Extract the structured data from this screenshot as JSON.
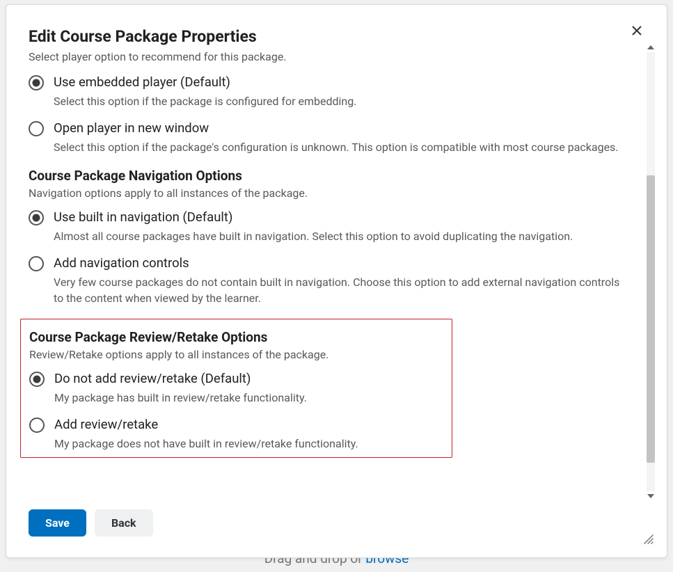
{
  "backdrop": {
    "drag_text": "Drag and drop or ",
    "browse": "browse"
  },
  "dialog": {
    "title": "Edit Course Package Properties",
    "subtitle": "Select player option to recommend for this package."
  },
  "player": {
    "options": [
      {
        "label": "Use embedded player (Default)",
        "desc": "Select this option if the package is configured for embedding.",
        "selected": true
      },
      {
        "label": "Open player in new window",
        "desc": "Select this option if the package's configuration is unknown. This option is compatible with most course packages.",
        "selected": false
      }
    ]
  },
  "navigation": {
    "heading": "Course Package Navigation Options",
    "subheading": "Navigation options apply to all instances of the package.",
    "options": [
      {
        "label": "Use built in navigation (Default)",
        "desc": "Almost all course packages have built in navigation. Select this option to avoid duplicating the navigation.",
        "selected": true
      },
      {
        "label": "Add navigation controls",
        "desc": "Very few course packages do not contain built in navigation. Choose this option to add external navigation controls to the content when viewed by the learner.",
        "selected": false
      }
    ]
  },
  "review": {
    "heading": "Course Package Review/Retake Options",
    "subheading": "Review/Retake options apply to all instances of the package.",
    "options": [
      {
        "label": "Do not add review/retake (Default)",
        "desc": "My package has built in review/retake functionality.",
        "selected": true
      },
      {
        "label": "Add review/retake",
        "desc": "My package does not have built in review/retake functionality.",
        "selected": false
      }
    ]
  },
  "footer": {
    "save": "Save",
    "back": "Back"
  }
}
